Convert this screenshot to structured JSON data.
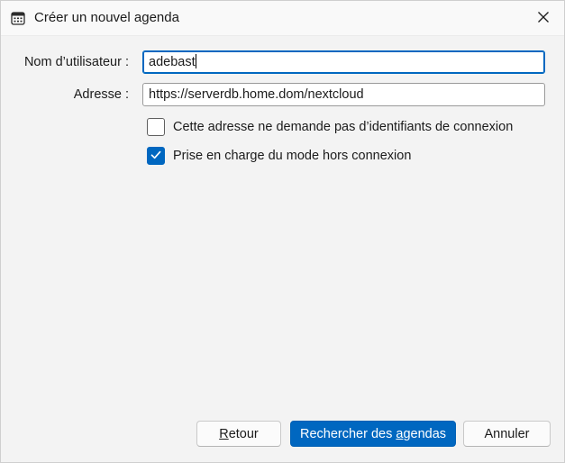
{
  "window": {
    "title": "Créer un nouvel agenda",
    "title_icon": "calendar-icon",
    "close_icon": "close-icon"
  },
  "form": {
    "username_label": "Nom d’utilisateur :",
    "username_value": "adebast",
    "address_label": "Adresse :",
    "address_value": "https://serverdb.home.dom/nextcloud",
    "no_credentials_label": "Cette adresse ne demande pas d’identifiants de connexion",
    "no_credentials_checked": false,
    "offline_label": "Prise en charge du mode hors connexion",
    "offline_checked": true
  },
  "buttons": {
    "back_accel": "R",
    "back_rest": "etour",
    "find_pre": "Rechercher des ",
    "find_accel": "a",
    "find_post": "gendas",
    "cancel_label": "Annuler"
  },
  "colors": {
    "accent": "#0067c0",
    "background": "#f3f3f3"
  }
}
